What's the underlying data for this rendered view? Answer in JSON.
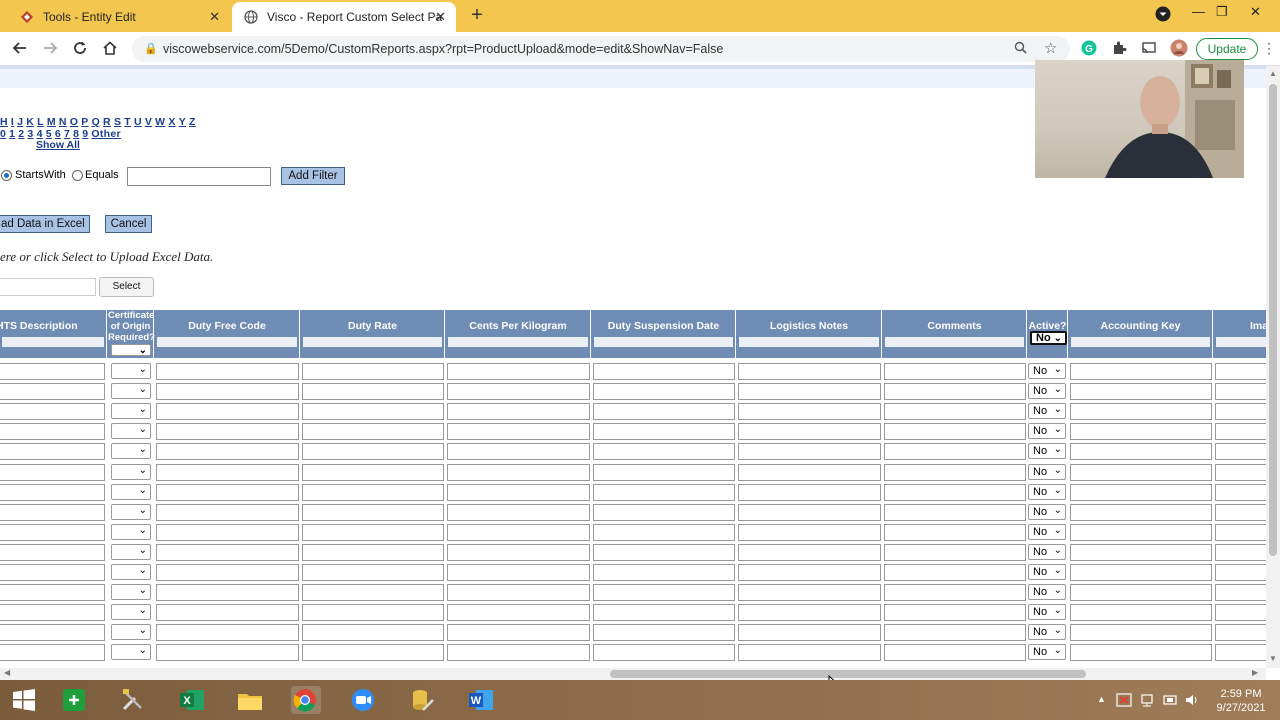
{
  "browser": {
    "tabs": [
      {
        "title": "Tools - Entity Edit",
        "active": false
      },
      {
        "title": "Visco - Report Custom Select Pa",
        "active": true
      }
    ],
    "url": "viscowebservice.com/5Demo/CustomReports.aspx?rpt=ProductUpload&mode=edit&ShowNav=False",
    "update_label": "Update"
  },
  "filters": {
    "alpha_row1": [
      "H",
      "I",
      "J",
      "K",
      "L",
      "M",
      "N",
      "O",
      "P",
      "Q",
      "R",
      "S",
      "T",
      "U",
      "V",
      "W",
      "X",
      "Y",
      "Z"
    ],
    "alpha_row2": [
      "0",
      "1",
      "2",
      "3",
      "4",
      "5",
      "6",
      "7",
      "8",
      "9",
      "Other"
    ],
    "show_all": "Show All",
    "starts_with_label": "StartsWith",
    "equals_label": "Equals",
    "add_filter_label": "Add Filter"
  },
  "actions": {
    "upload_excel_label": "ad Data in Excel",
    "cancel_label": "Cancel",
    "upload_note": "ere or click Select to Upload Excel Data.",
    "select_label": "Select"
  },
  "grid": {
    "columns": [
      {
        "label": "HTS Description",
        "type": "text"
      },
      {
        "label": "Certificate of Origin Required?",
        "type": "select"
      },
      {
        "label": "Duty Free Code",
        "type": "text"
      },
      {
        "label": "Duty Rate",
        "type": "text"
      },
      {
        "label": "Cents Per Kilogram",
        "type": "text"
      },
      {
        "label": "Duty Suspension Date",
        "type": "text"
      },
      {
        "label": "Logistics Notes",
        "type": "text"
      },
      {
        "label": "Comments",
        "type": "text"
      },
      {
        "label": "Active?",
        "type": "select"
      },
      {
        "label": "Accounting Key",
        "type": "text"
      },
      {
        "label": "Ima",
        "type": "text"
      }
    ],
    "cert_header_lines": [
      "Certificate",
      "of Origin",
      "Required?"
    ],
    "active_filter_value": "No",
    "active_default": "No",
    "row_count": 15
  },
  "taskbar": {
    "time": "2:59 PM",
    "date": "9/27/2021"
  },
  "colors": {
    "tabbar": "#f3c64f",
    "grid_header": "#6f8cb4",
    "button_blue": "#a9c3e5",
    "link_blue": "#1a3e8c"
  }
}
